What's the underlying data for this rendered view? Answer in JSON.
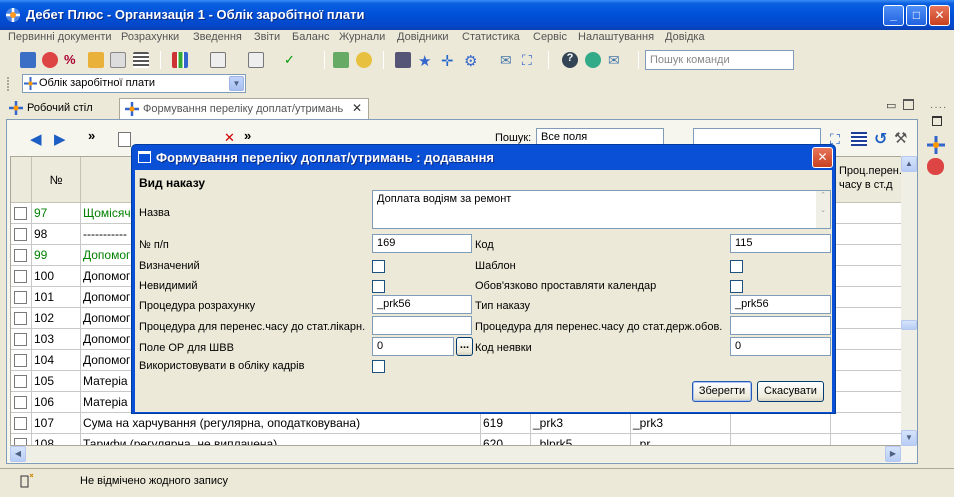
{
  "window": {
    "title": "Дебет Плюс - Организація 1 - Облік заробітної плати"
  },
  "menu": [
    "Первинні документи",
    "Розрахунки",
    "Зведення",
    "Звіти",
    "Баланс",
    "Журнали",
    "Довідники",
    "Статистика",
    "Сервіс",
    "Налаштування",
    "Довідка"
  ],
  "toolbar": {
    "search_placeholder": "Пошук команди",
    "module_value": "Облік заробітної плати"
  },
  "tabs": [
    {
      "label": "Робочий стіл",
      "active": false
    },
    {
      "label": "Формування переліку доплат/утримань",
      "active": true
    }
  ],
  "inner_toolbar": {
    "search_label": "Пошук:",
    "search_field_value": "Все поля"
  },
  "grid": {
    "header_number": "№",
    "header_right": "Проц.перен. часу в ст.д",
    "rows": [
      {
        "n": "97",
        "name": "Щомісяч",
        "green": true,
        "c1": "",
        "c2": "",
        "c3": ""
      },
      {
        "n": "98",
        "name": "-----------",
        "green": false,
        "c1": "",
        "c2": "",
        "c3": ""
      },
      {
        "n": "99",
        "name": "Допомог",
        "green": true,
        "c1": "",
        "c2": "",
        "c3": ""
      },
      {
        "n": "100",
        "name": "Допомог",
        "green": false,
        "c1": "",
        "c2": "",
        "c3": ""
      },
      {
        "n": "101",
        "name": "Допомог",
        "green": false,
        "c1": "",
        "c2": "",
        "c3": ""
      },
      {
        "n": "102",
        "name": "Допомог",
        "green": false,
        "c1": "",
        "c2": "",
        "c3": ""
      },
      {
        "n": "103",
        "name": "Допомог",
        "green": false,
        "c1": "",
        "c2": "",
        "c3": ""
      },
      {
        "n": "104",
        "name": "Допомог",
        "green": false,
        "c1": "",
        "c2": "",
        "c3": ""
      },
      {
        "n": "105",
        "name": "Матеріа",
        "green": false,
        "c1": "",
        "c2": "",
        "c3": ""
      },
      {
        "n": "106",
        "name": "Матеріа",
        "green": false,
        "c1": "",
        "c2": "",
        "c3": ""
      },
      {
        "n": "107",
        "name": "Сума на харчування (регулярна, оподатковувана)",
        "green": false,
        "c1": "619",
        "c2": "_prk3",
        "c3": "_prk3"
      },
      {
        "n": "108",
        "name": "Тарифи (регулярна, не виплачена)",
        "green": false,
        "c1": "620",
        "c2": "_blprk5",
        "c3": "_pr"
      }
    ]
  },
  "status": {
    "text": "Не відмічено жодного запису"
  },
  "dialog": {
    "title": "Формування переліку доплат/утримань : додавання",
    "section": "Вид наказу",
    "name_label": "Назва",
    "name_value": "Доплата водіям за ремонт",
    "num_label": "№ п/п",
    "num_value": "169",
    "code_label": "Код",
    "code_value": "115",
    "defined_label": "Визначений",
    "template_label": "Шаблон",
    "invisible_label": "Невидимий",
    "calendar_label": "Обов'язково проставляти календар",
    "calc_proc_label": "Процедура розрахунку",
    "calc_proc_value": "_prk56",
    "order_type_label": "Тип наказу",
    "order_type_value": "_prk56",
    "proc_sick_label": "Процедура для перенес.часу до стат.лікарн.",
    "proc_sick_value": "",
    "proc_state_label": "Процедура для перенес.часу до стат.держ.обов.",
    "proc_state_value": "",
    "or_field_label": "Поле ОР для ШВВ",
    "or_field_value": "0",
    "absence_label": "Код неявки",
    "absence_value": "0",
    "hr_label": "Використовувати в обліку кадрів",
    "browse_label": "...",
    "save_label": "Зберегти",
    "cancel_label": "Скасувати"
  },
  "colors": {
    "titlebar": "#0050d8",
    "green_text": "#008000",
    "dialog_border": "#0a50d6"
  }
}
